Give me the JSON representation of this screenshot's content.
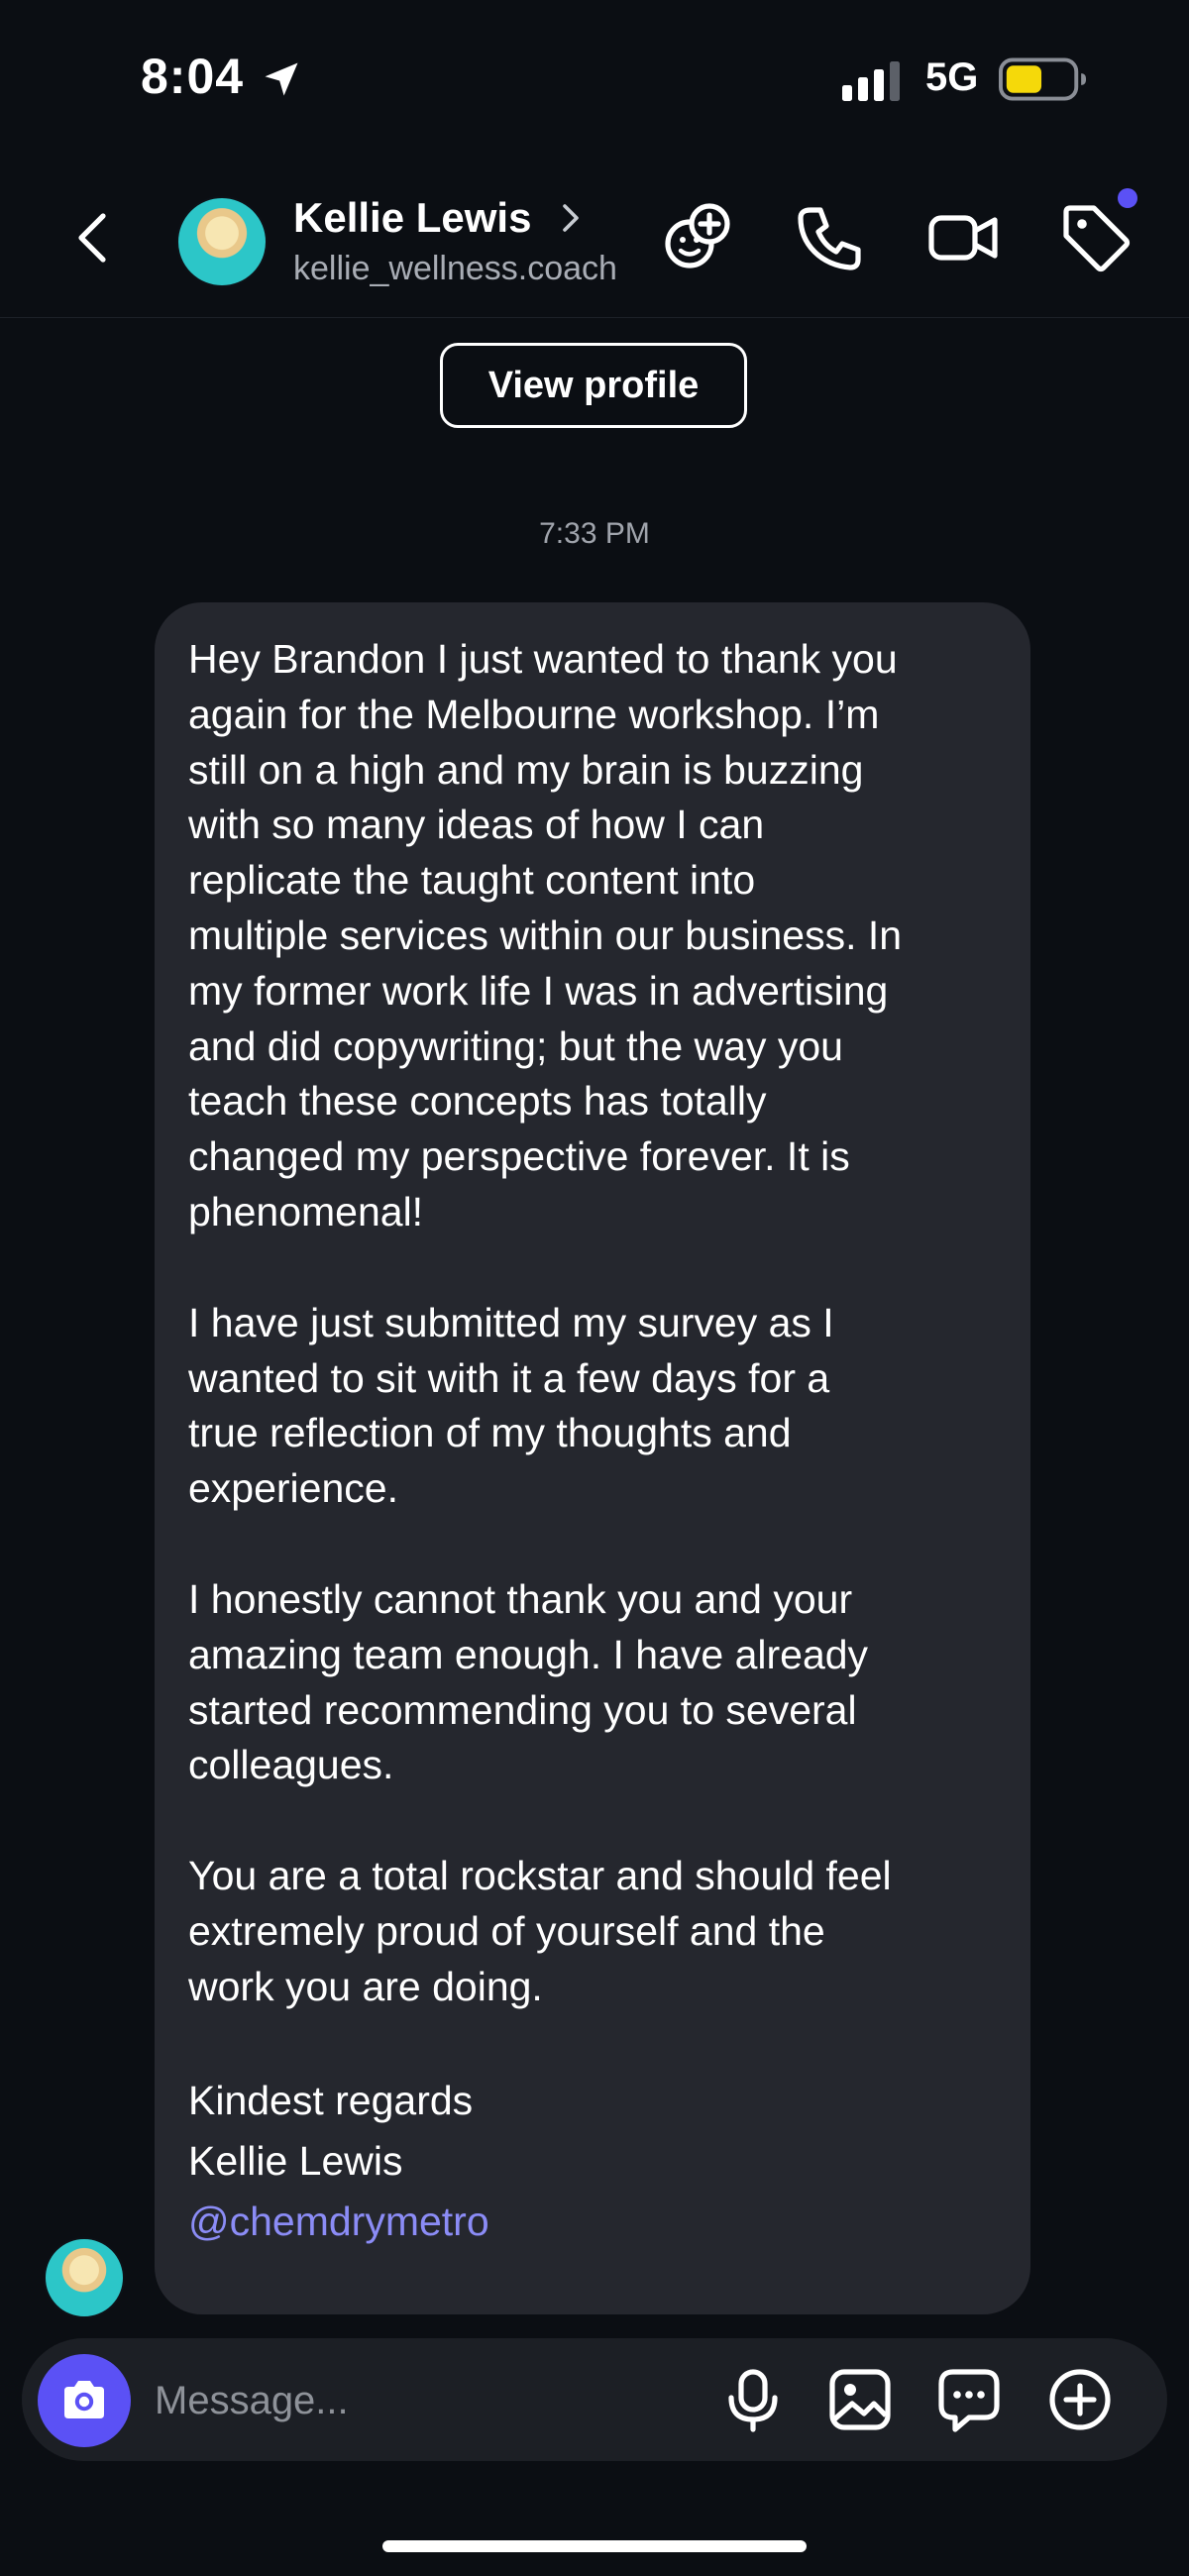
{
  "status_bar": {
    "time": "8:04",
    "network": "5G",
    "battery_color": "#f5d90a"
  },
  "header": {
    "name": "Kellie Lewis",
    "handle": "kellie_wellness.coach",
    "icons": [
      "back-icon",
      "chevron-right-icon",
      "effects-icon",
      "phone-icon",
      "video-icon",
      "tag-icon"
    ],
    "notification_dot_color": "#5b51f5"
  },
  "view_profile_label": "View profile",
  "conversation": {
    "timestamp": "7:33 PM",
    "message": {
      "paragraphs": [
        "Hey Brandon I just wanted to thank you\nagain for the Melbourne workshop. I’m\nstill on a high and my brain is buzzing\nwith so many ideas of how I can\nreplicate the taught content into\nmultiple services within our business. In\nmy former work life I was in advertising\nand did copywriting; but the way you\nteach these concepts has totally\nchanged my perspective forever. It is\nphenomenal!",
        "I have just submitted my survey as I\nwanted to sit with it a few days for a\ntrue reflection of my thoughts and\nexperience.",
        "I honestly cannot thank you and your\namazing team enough. I have already\nstarted recommending you to several\ncolleagues.",
        "You are a total rockstar and should feel\nextremely proud of yourself and the\nwork you are doing."
      ],
      "signoff": "Kindest regards",
      "signature_name": "Kellie Lewis",
      "mention": "@chemdrymetro",
      "bubble_color": "#25272e",
      "mention_color": "#8b8cf6"
    }
  },
  "composer": {
    "placeholder": "Message...",
    "accent_color": "#5b51f5",
    "icons": [
      "camera-icon",
      "microphone-icon",
      "gallery-icon",
      "sticker-icon",
      "plus-icon"
    ]
  }
}
